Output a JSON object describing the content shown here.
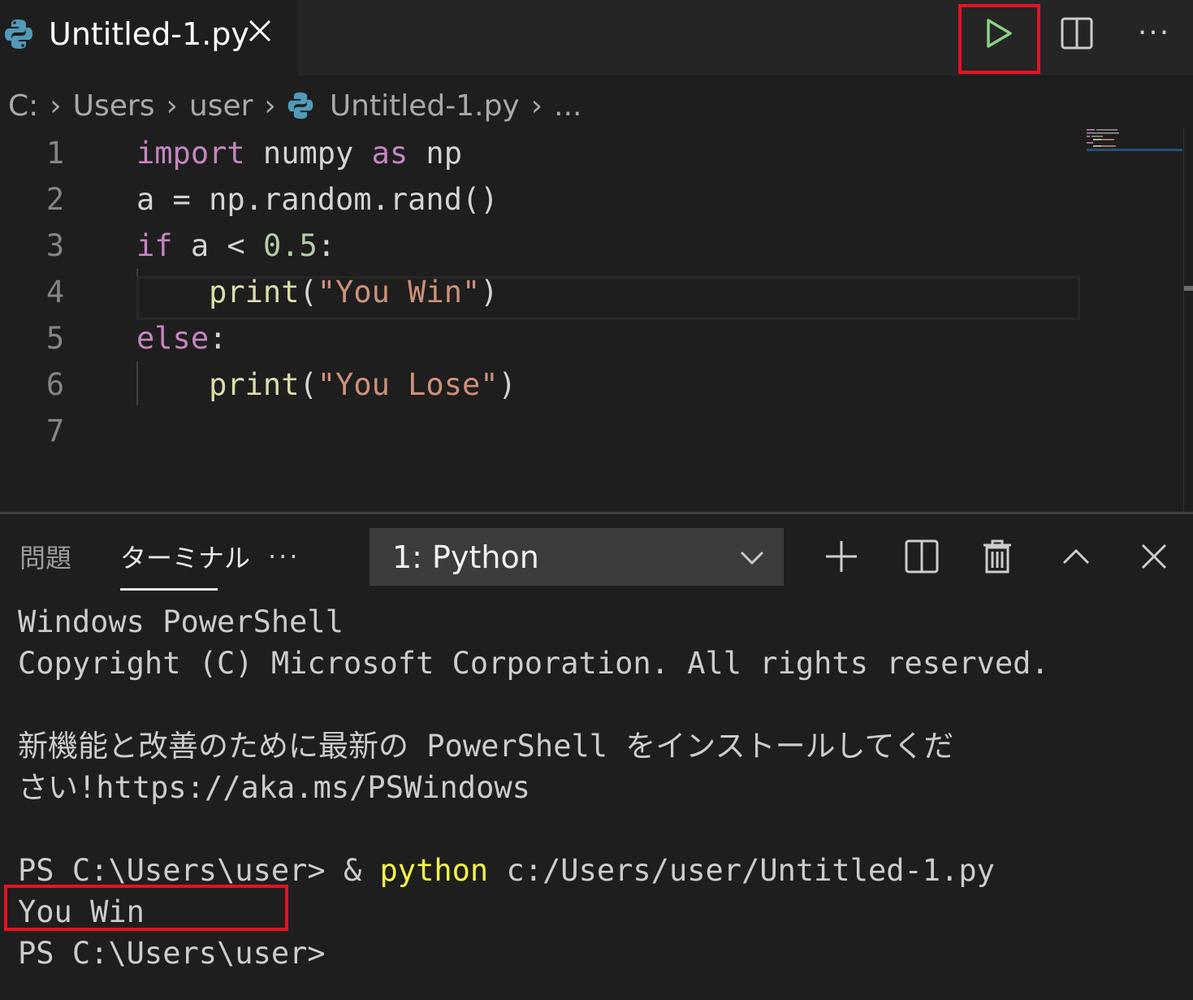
{
  "tab": {
    "label": "Untitled-1.py",
    "icon": "python-icon"
  },
  "toolbar": {
    "run": "run-python-file-icon",
    "split": "split-editor-icon",
    "more": "···"
  },
  "breadcrumb": [
    "C:",
    "Users",
    "user",
    "Untitled-1.py",
    "..."
  ],
  "editor": {
    "line_numbers": [
      "1",
      "2",
      "3",
      "4",
      "5",
      "6",
      "7"
    ]
  },
  "panel": {
    "tab_problems": "問題",
    "tab_terminal": "ターミナル",
    "more": "···",
    "terminal_select": "1: Python"
  },
  "terminal": {
    "line1": "Windows PowerShell",
    "line2": "Copyright (C) Microsoft Corporation. All rights reserved.",
    "line3": "新機能と改善のために最新の PowerShell をインストールしてくだ",
    "line4": "さい!https://aka.ms/PSWindows",
    "prompt1": "PS C:\\Users\\user> & ",
    "cmd": "python",
    "args": " c:/Users/user/Untitled-1.py",
    "output": "You Win",
    "prompt2": "PS C:\\Users\\user>"
  },
  "colors": {
    "highlight": "#e81123",
    "run_green": "#89d185"
  }
}
